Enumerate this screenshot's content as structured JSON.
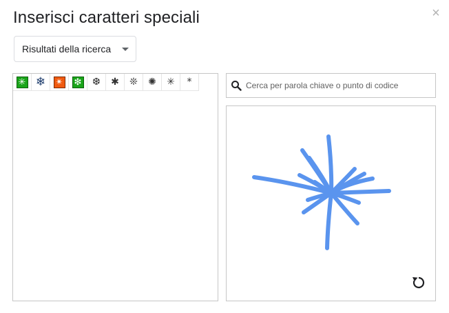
{
  "dialog": {
    "title": "Inserisci caratteri speciali",
    "close_symbol": "×"
  },
  "category": {
    "selected": "Risultati della ricerca"
  },
  "results": {
    "characters": [
      {
        "char": "✳",
        "style": "green-box",
        "icon": "eight-spoked-asterisk-icon"
      },
      {
        "char": "❄",
        "style": "snowflake",
        "icon": "snowflake-icon"
      },
      {
        "char": "✴",
        "style": "orange-box",
        "icon": "eight-pointed-star-icon"
      },
      {
        "char": "❇",
        "style": "green-box",
        "icon": "sparkle-icon"
      },
      {
        "char": "❆",
        "style": "plain",
        "icon": "heavy-chevron-snowflake-icon"
      },
      {
        "char": "✱",
        "style": "plain",
        "icon": "heavy-asterisk-icon"
      },
      {
        "char": "❊",
        "style": "plain",
        "icon": "teardrop-propeller-asterisk-icon"
      },
      {
        "char": "✺",
        "style": "plain",
        "icon": "sixteen-pointed-asterisk-icon"
      },
      {
        "char": "✳",
        "style": "plain",
        "icon": "light-asterisk-icon"
      },
      {
        "char": "*",
        "style": "plain",
        "icon": "asterisk-icon"
      }
    ]
  },
  "search": {
    "placeholder": "Cerca per parola chiave o punto di codice",
    "value": ""
  },
  "drawing_area": {
    "stroke_color": "#5a94ee",
    "reset_icon": "reset-icon"
  },
  "colors": {
    "green_box": "#1aa51a",
    "orange_box": "#f05a0f",
    "border": "#c6c6c6"
  }
}
